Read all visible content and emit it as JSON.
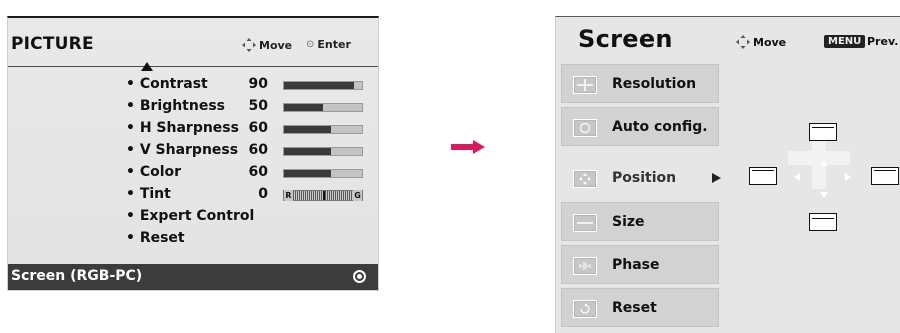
{
  "picture_menu": {
    "title": "PICTURE",
    "hint_move": "Move",
    "hint_enter": "Enter",
    "items": [
      {
        "label": "• Contrast",
        "value": "90",
        "level": 0.9
      },
      {
        "label": "• Brightness",
        "value": "50",
        "level": 0.5
      },
      {
        "label": "• H Sharpness",
        "value": "60",
        "level": 0.6
      },
      {
        "label": "• V Sharpness",
        "value": "60",
        "level": 0.6
      },
      {
        "label": "• Color",
        "value": "60",
        "level": 0.6
      },
      {
        "label": "• Tint",
        "value": "0",
        "tint_left": "R",
        "tint_right": "G"
      },
      {
        "label": "• Expert Control"
      },
      {
        "label": "• Reset"
      }
    ],
    "footer_label": "Screen (RGB-PC)"
  },
  "screen_menu": {
    "title": "Screen",
    "hint_move": "Move",
    "menu_key": "MENU",
    "hint_prev": "Prev.",
    "items": [
      {
        "label": "Resolution",
        "icon": "plus-icon"
      },
      {
        "label": "Auto config.",
        "icon": "circle-icon"
      },
      {
        "label": "Position",
        "icon": "move-arrows-icon",
        "active": true
      },
      {
        "label": "Size",
        "icon": "minus-icon"
      },
      {
        "label": "Phase",
        "icon": "phase-icon"
      },
      {
        "label": "Reset",
        "icon": "reset-icon"
      }
    ]
  },
  "colors": {
    "panel_bg": "#e6e6e6",
    "footer_bg": "#3c3c3c",
    "arrow": "#d81b60",
    "bar_fill": "#3a3a3a"
  }
}
